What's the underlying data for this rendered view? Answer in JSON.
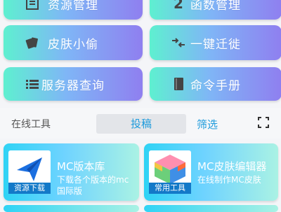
{
  "menu": {
    "resource_manage": "资源管理",
    "function_manage": "函数管理",
    "skin_stealer": "皮肤小偷",
    "one_click_migrate": "一键迁徙",
    "server_query": "服务器查询",
    "command_manual": "命令手册"
  },
  "tabs": {
    "title": "在线工具",
    "submit": "投稿",
    "filter": "筛选"
  },
  "cards": [
    {
      "title": "MC版本库",
      "desc": "下载各个版本的mc国际版",
      "badge": "资源下载"
    },
    {
      "title": "MC皮肤编辑器",
      "desc": "在线制作MC皮肤",
      "badge": "常用工具"
    }
  ],
  "colors": {
    "button_gradient_start": "#5ef0d0",
    "button_gradient_end": "#8f7ff0",
    "accent": "#1e9bdc",
    "badge_bg": "#1379c8"
  }
}
